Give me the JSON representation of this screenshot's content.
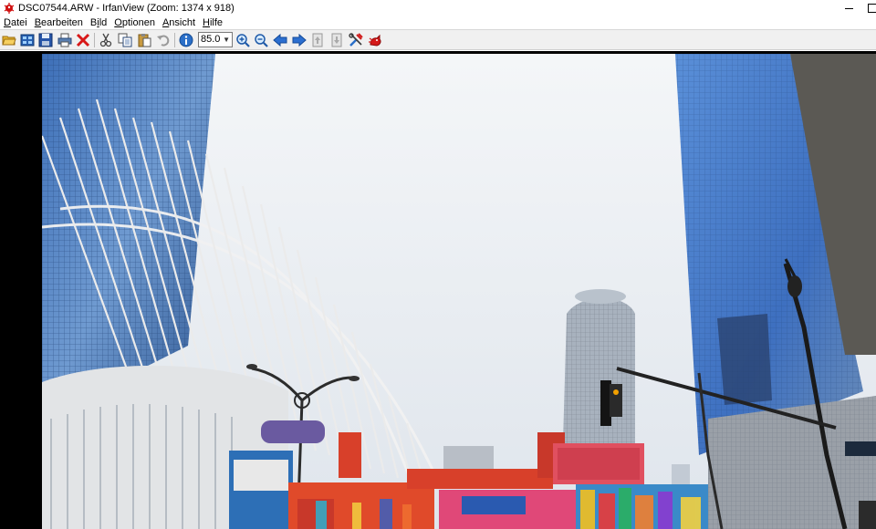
{
  "window": {
    "title": "DSC07544.ARW - IrfanView (Zoom: 1374 x 918)",
    "app_icon": "irfanview-icon",
    "minimize_glyph": "minimize-icon",
    "maximize_glyph": "maximize-icon"
  },
  "menu": [
    {
      "pre": "",
      "acc": "D",
      "post": "atei"
    },
    {
      "pre": "",
      "acc": "B",
      "post": "earbeiten"
    },
    {
      "pre": "B",
      "acc": "i",
      "post": "ld"
    },
    {
      "pre": "",
      "acc": "O",
      "post": "ptionen"
    },
    {
      "pre": "",
      "acc": "A",
      "post": "nsicht"
    },
    {
      "pre": "",
      "acc": "H",
      "post": "ilfe"
    }
  ],
  "toolbar": {
    "zoom_value": "85.0",
    "icons": [
      "open-icon",
      "thumbnails-icon",
      "save-icon",
      "print-icon",
      "delete-icon",
      "cut-icon",
      "copy-icon",
      "paste-icon",
      "undo-icon",
      "info-icon",
      "zoom-in-icon",
      "zoom-out-icon",
      "previous-icon",
      "next-icon",
      "page-up-icon",
      "page-down-icon",
      "settings-icon",
      "irfanview-logo-icon"
    ]
  },
  "image": {
    "description_type": "photo-view",
    "content": "urban-architecture-photo"
  },
  "colors": {
    "sky": "#e8ecf0",
    "glass_blue": "#4a78b8",
    "frame": "#000000",
    "toolbar_bg": "#f0f0f0"
  }
}
